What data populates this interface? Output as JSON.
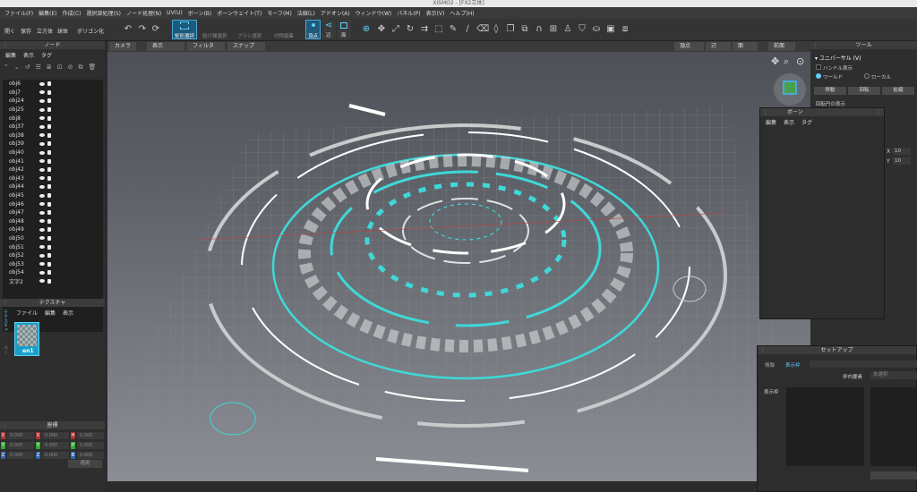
{
  "window": {
    "title": "XISMO2 - [FX2立体]"
  },
  "menu": [
    "ファイル(F)",
    "編集(E)",
    "作成(C)",
    "選択部処理(S)",
    "ノード処理(N)",
    "UV(U)",
    "ボーン(B)",
    "ボーンウェイト(T)",
    "モーフ(M)",
    "法線(L)",
    "アドオン(A)",
    "ウィンドウ(W)",
    "パネル(P)",
    "表示(V)",
    "ヘルプ(H)"
  ],
  "toolbar": {
    "open": "開く",
    "save": "保存",
    "cube": "立方体",
    "sphere": "球体",
    "polygon": "ポリゴン化",
    "rect_select": "矩形選択",
    "lasso_select": "投げ縄選択",
    "brush_select": "ブラシ選択",
    "symmetry": "対称編集",
    "vertex": "頂点",
    "edge": "辺",
    "face": "面"
  },
  "node_panel": {
    "title": "ノード",
    "menu": [
      "編集",
      "表示",
      "タグ"
    ],
    "items": [
      "obj6",
      "obj7",
      "obj24",
      "obj25",
      "obj8",
      "obj37",
      "obj38",
      "obj39",
      "obj40",
      "obj41",
      "obj42",
      "obj43",
      "obj44",
      "obj45",
      "obj46",
      "obj47",
      "obj48",
      "obj49",
      "obj50",
      "obj51",
      "obj52",
      "obj53",
      "obj54",
      "文字2"
    ]
  },
  "texture_panel": {
    "title": "テクスチャ",
    "menu": [
      "ファイル",
      "編集",
      "表示"
    ],
    "side_tab": "テクスチャ",
    "side_tab2": "ペー",
    "item": "en1"
  },
  "coord_panel": {
    "title": "座標",
    "rows": [
      [
        "X",
        "0.000",
        "X",
        "0.000",
        "H",
        "0.000"
      ],
      [
        "Y",
        "0.000",
        "Y",
        "0.000",
        "P",
        "0.000"
      ],
      [
        "Z",
        "0.000",
        "Z",
        "0.000",
        "B",
        "0.000"
      ]
    ],
    "apply": "適用"
  },
  "viewport": {
    "camera": "カメラ",
    "display": "表示",
    "filter": "フィルタ",
    "snap": "スナップ",
    "view_vertex": "頂点",
    "view_edge": "辺",
    "view_face": "面",
    "view_front": "前面"
  },
  "tool_panel": {
    "title": "ツール",
    "mode": "ユニバーサル (V)",
    "handle": "ハンドル表示",
    "world": "ワールド",
    "local": "ローカル",
    "move": "移動",
    "rotate": "回転",
    "scale": "拡縮",
    "show_rot": "回転円の表示",
    "x_label": "X",
    "x_val": "10",
    "y_label": "Y",
    "y_val": "10"
  },
  "bone_panel": {
    "title": "ボーン",
    "menu": [
      "編集",
      "表示",
      "タグ"
    ]
  },
  "setup_panel": {
    "title": "セットアップ",
    "tab1": "情報",
    "tab2": "表示枠",
    "frame_elem": "枠内要素",
    "unselected": "未選択",
    "display_frame": "表示枠"
  }
}
